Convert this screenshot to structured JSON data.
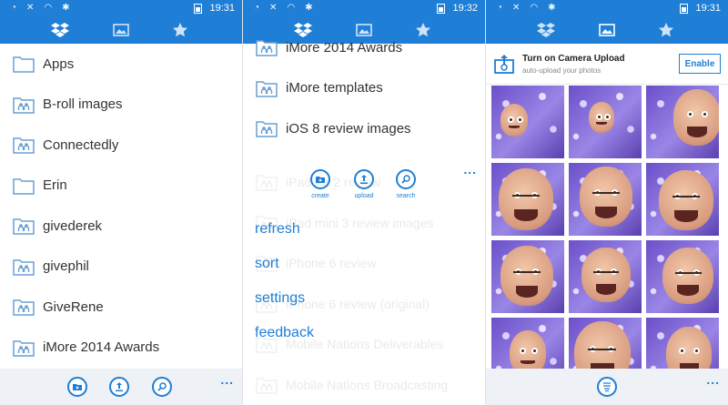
{
  "panel1": {
    "status": {
      "time": "19:31"
    },
    "folders": [
      {
        "name": "Apps",
        "shared": false
      },
      {
        "name": "B-roll images",
        "shared": true
      },
      {
        "name": "Connectedly",
        "shared": true
      },
      {
        "name": "Erin",
        "shared": false
      },
      {
        "name": "givederek",
        "shared": true
      },
      {
        "name": "givephil",
        "shared": true
      },
      {
        "name": "GiveRene",
        "shared": true
      },
      {
        "name": "iMore 2014 Awards",
        "shared": true
      }
    ],
    "more": "..."
  },
  "panel2": {
    "status": {
      "time": "19:32"
    },
    "folders": [
      {
        "name": "iMore 2014 Awards",
        "shared": true
      },
      {
        "name": "iMore templates",
        "shared": true
      },
      {
        "name": "iOS 8 review images",
        "shared": true
      }
    ],
    "ghost_folders": [
      "iPad Air 2 review",
      "iPad mini 3 review images",
      "iPhone 6 review",
      "iPhone 6 review (original)",
      "Mobile Nations Deliverables",
      "Mobile Nations Broadcasting"
    ],
    "app_buttons": {
      "create": "create",
      "upload": "upload",
      "search": "search"
    },
    "menu": {
      "refresh": "refresh",
      "sort": "sort",
      "settings": "settings",
      "feedback": "feedback"
    },
    "more": "..."
  },
  "panel3": {
    "status": {
      "time": "19:31"
    },
    "banner": {
      "title": "Turn on Camera Upload",
      "subtitle": "auto-upload your photos",
      "enable": "Enable"
    },
    "more": "..."
  },
  "colors": {
    "accent": "#1f7ed6",
    "statusbar": "#1f7ed6",
    "text": "#333333",
    "bottombar": "#eef1f5"
  }
}
